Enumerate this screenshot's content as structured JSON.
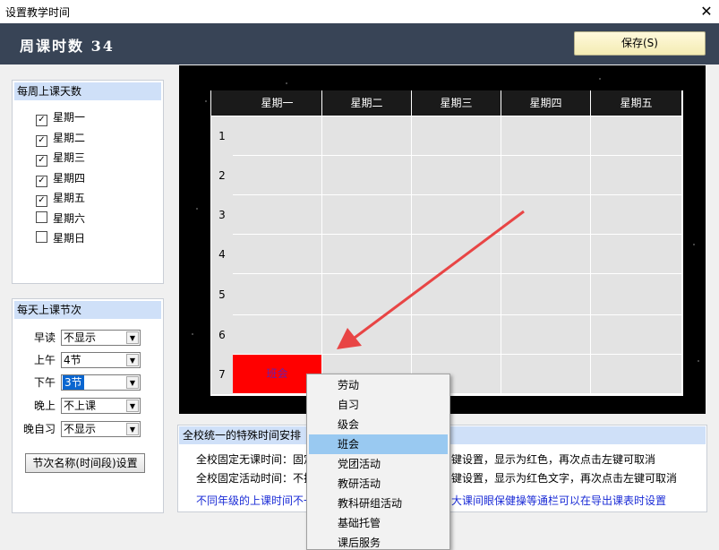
{
  "window": {
    "title": "设置教学时间",
    "close_glyph": "✕"
  },
  "header": {
    "title": "周课时数 34",
    "save_label": "保存(S)"
  },
  "weekdays_group": {
    "title": "每周上课天数",
    "items": [
      {
        "label": "星期一",
        "checked": true
      },
      {
        "label": "星期二",
        "checked": true
      },
      {
        "label": "星期三",
        "checked": true
      },
      {
        "label": "星期四",
        "checked": true
      },
      {
        "label": "星期五",
        "checked": true
      },
      {
        "label": "星期六",
        "checked": false
      },
      {
        "label": "星期日",
        "checked": false
      }
    ]
  },
  "periods_group": {
    "title": "每天上课节次",
    "rows": [
      {
        "label": "早读",
        "value": "不显示"
      },
      {
        "label": "上午",
        "value": "4节"
      },
      {
        "label": "下午",
        "value": "3节"
      },
      {
        "label": "晚上",
        "value": "不上课"
      },
      {
        "label": "晚自习",
        "value": "不显示"
      }
    ],
    "period_button": "节次名称(时间段)设置"
  },
  "timetable": {
    "columns": [
      "星期一",
      "星期二",
      "星期三",
      "星期四",
      "星期五"
    ],
    "rows": [
      "1",
      "2",
      "3",
      "4",
      "5",
      "6",
      "7"
    ],
    "marked_cell": {
      "row": "7",
      "column": "星期一",
      "text": "班会",
      "color": "#ff0000"
    }
  },
  "notice": {
    "title": "全校统一的特殊时间安排",
    "line1_left": "全校固定无课时间：固定",
    "line1_right": "键设置，显示为红色，再次点击左键可取消",
    "line2_left": "全校固定活动时间：不排",
    "line2_right": "键设置，显示为红色文字，再次点击左键可取消",
    "line3_left": "不同年级的上课时间不一",
    "line3_right": "大课间眼保健操等通栏可以在导出课表时设置"
  },
  "context_menu": {
    "items": [
      "劳动",
      "自习",
      "级会",
      "班会",
      "党团活动",
      "教研活动",
      "教科研组活动",
      "基础托管",
      "课后服务"
    ],
    "highlighted": "班会"
  },
  "colors": {
    "header_bg": "#384456",
    "accent_red": "#ff0000",
    "menu_highlight": "#99c9f1",
    "arrow": "#e84545"
  }
}
